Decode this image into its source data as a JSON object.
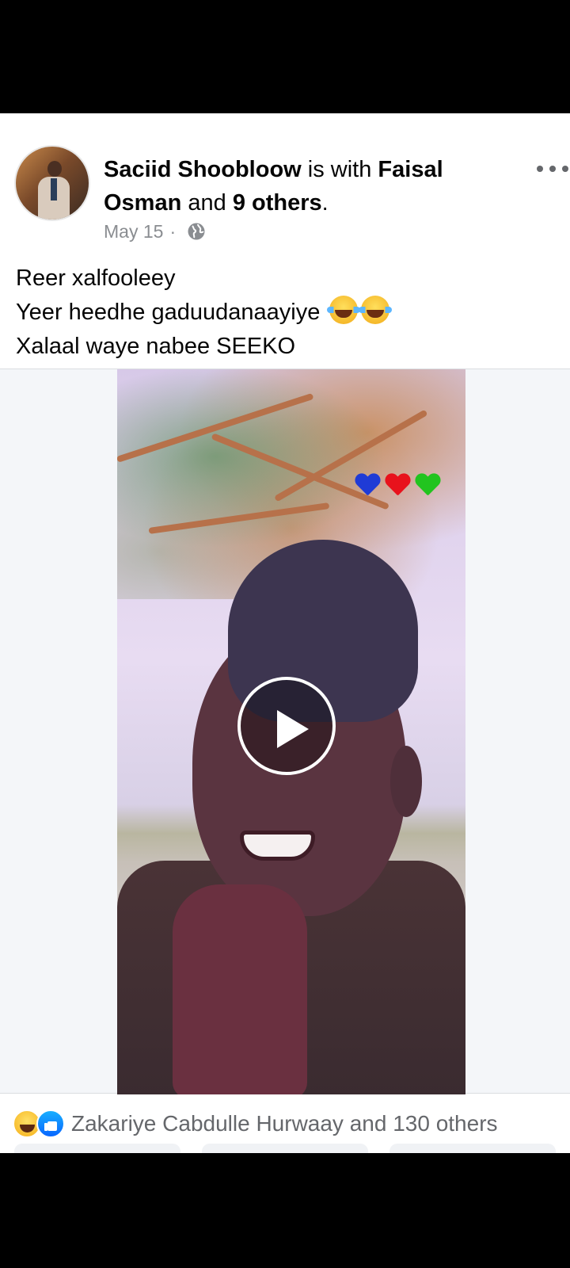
{
  "post": {
    "author": "Saciid Shoobloow",
    "with_text": " is with ",
    "tagged_first": "Faisal Osman",
    "and_text": " and ",
    "tagged_others": "9 others",
    "period": ".",
    "date": "May 15",
    "separator": "·",
    "audience_icon": "globe-icon",
    "caption_lines": [
      "Reer xalfooleey",
      "Yeer heedhe gaduudanaayiye",
      "Xalaal waye nabee SEEKO"
    ]
  },
  "media": {
    "type": "video",
    "play_icon": "play-icon",
    "overlay_hearts": [
      "#1f3bd6",
      "#e8121c",
      "#22c41f"
    ]
  },
  "reactions": {
    "icons": [
      "haha-icon",
      "like-icon"
    ],
    "summary": "Zakariye Cabdulle Hurwaay and 130 others"
  },
  "colors": {
    "text": "#050505",
    "secondary": "#65676b",
    "meta": "#8a8d91",
    "like_blue": "#0866ff"
  }
}
